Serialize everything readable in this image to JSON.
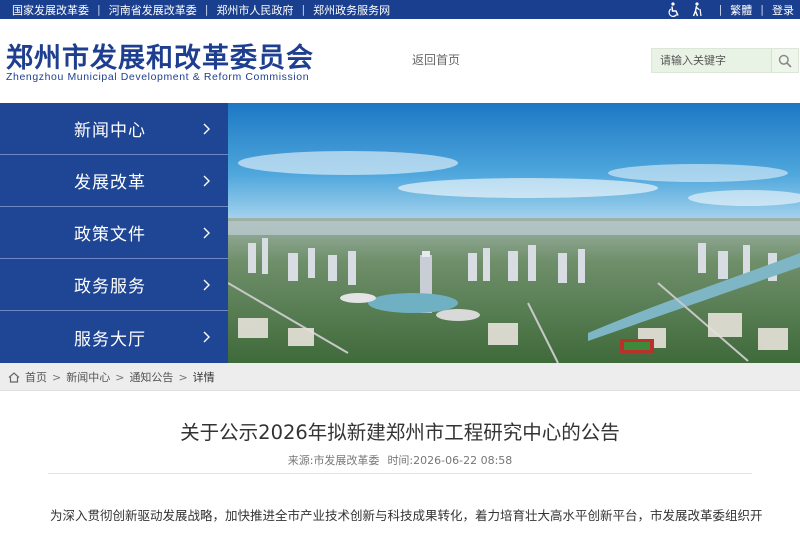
{
  "topbar": {
    "links": [
      "国家发展改革委",
      "河南省发展改革委",
      "郑州市人民政府",
      "郑州政务服务网"
    ],
    "traditional": "繁體",
    "login": "登录",
    "accessibility_icon": "accessibility-icon"
  },
  "header": {
    "logo_cn": "郑州市发展和改革委员会",
    "logo_en": "Zhengzhou Municipal Development & Reform Commission",
    "home_link": "返回首页",
    "search_placeholder": "请输入关键字",
    "search_icon": "search-icon"
  },
  "nav": {
    "items": [
      {
        "label": "新闻中心"
      },
      {
        "label": "发展改革"
      },
      {
        "label": "政策文件"
      },
      {
        "label": "政务服务"
      },
      {
        "label": "服务大厅"
      }
    ]
  },
  "breadcrumb": {
    "home": "首页",
    "news": "新闻中心",
    "notice": "通知公告",
    "current": "详情"
  },
  "article": {
    "title": "关于公示2026年拟新建郑州市工程研究中心的公告",
    "source_label": "来源:",
    "source": "市发展改革委",
    "time_label": "时间:",
    "time": "2026-06-22 08:58",
    "paragraph": "为深入贯彻创新驱动发展战略，加快推进全市产业技术创新与科技成果转化，着力培育壮大高水平创新平台，市发展改革委组织开"
  },
  "colors": {
    "brand_blue": "#1e3f8f",
    "topbar": "#1a3f8e",
    "nav": "#1f4595",
    "search_bg": "#e9f3e5"
  }
}
